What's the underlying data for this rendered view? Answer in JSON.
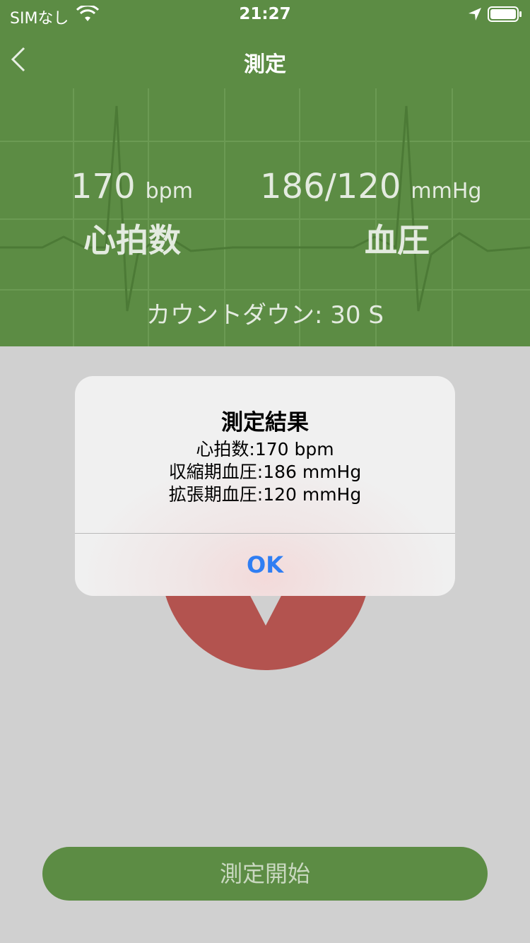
{
  "status_bar": {
    "carrier": "SIMなし",
    "time": "21:27"
  },
  "nav": {
    "title": "測定",
    "back_icon": "chevron-left-icon"
  },
  "metrics": {
    "heart_rate": {
      "value": "170",
      "unit": "bpm",
      "label": "心拍数"
    },
    "blood_pressure": {
      "value": "186/120",
      "unit": "mmHg",
      "label": "血圧"
    }
  },
  "countdown": "カウントダウン:  30 S",
  "alert": {
    "title": "測定結果",
    "lines": [
      "心拍数:170 bpm",
      "収縮期血圧:186 mmHg",
      "拡張期血圧:120 mmHg"
    ],
    "ok_label": "OK"
  },
  "start_button": {
    "label": "測定開始"
  },
  "colors": {
    "header_green": "#5c8c44",
    "dim_background": "#d0d0d0",
    "heart_red": "#b3534f",
    "alert_button_blue": "#2f7ef3"
  },
  "icons": [
    "wifi-icon",
    "location-arrow-icon",
    "battery-icon",
    "chevron-left-icon",
    "heart-icon"
  ]
}
